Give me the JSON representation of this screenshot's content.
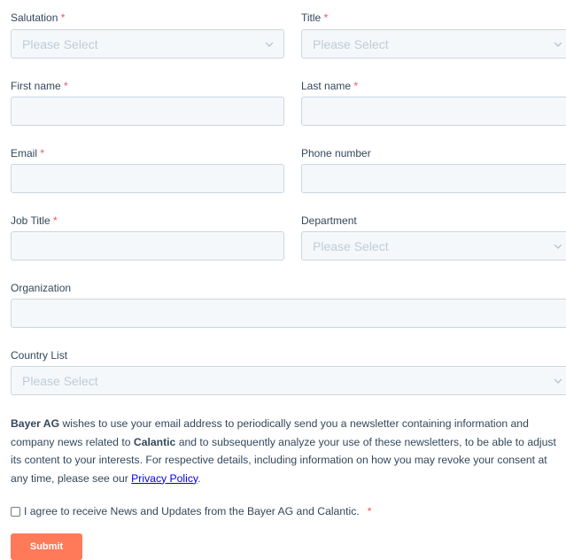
{
  "form": {
    "salutation": {
      "label": "Salutation",
      "req": "*",
      "placeholder": "Please Select"
    },
    "title": {
      "label": "Title",
      "req": "*",
      "placeholder": "Please Select"
    },
    "first_name": {
      "label": "First name",
      "req": "*"
    },
    "last_name": {
      "label": "Last name",
      "req": "*"
    },
    "email": {
      "label": "Email",
      "req": "*"
    },
    "phone": {
      "label": "Phone number"
    },
    "job_title": {
      "label": "Job Title",
      "req": "*"
    },
    "department": {
      "label": "Department",
      "placeholder": "Please Select"
    },
    "organization": {
      "label": "Organization"
    },
    "country": {
      "label": "Country List",
      "placeholder": "Please Select"
    }
  },
  "consent": {
    "company": "Bayer AG",
    "text1": " wishes to use your email address to periodically send you a newsletter containing information and company news related to ",
    "partner": "Calantic",
    "text2": " and to subsequently analyze your use of these newsletters, to be able to adjust its content to your interests. For respective details, including information on how you may revoke your consent at any time, please see our ",
    "link": "Privacy Policy",
    "text3": "."
  },
  "agree": {
    "label": "I agree to receive News and Updates from the Bayer AG and Calantic.",
    "req": "*"
  },
  "submit_label": "Submit",
  "colors": {
    "accent": "#ff7a59",
    "required": "#f2545b",
    "field_bg": "#f5f8fa"
  }
}
